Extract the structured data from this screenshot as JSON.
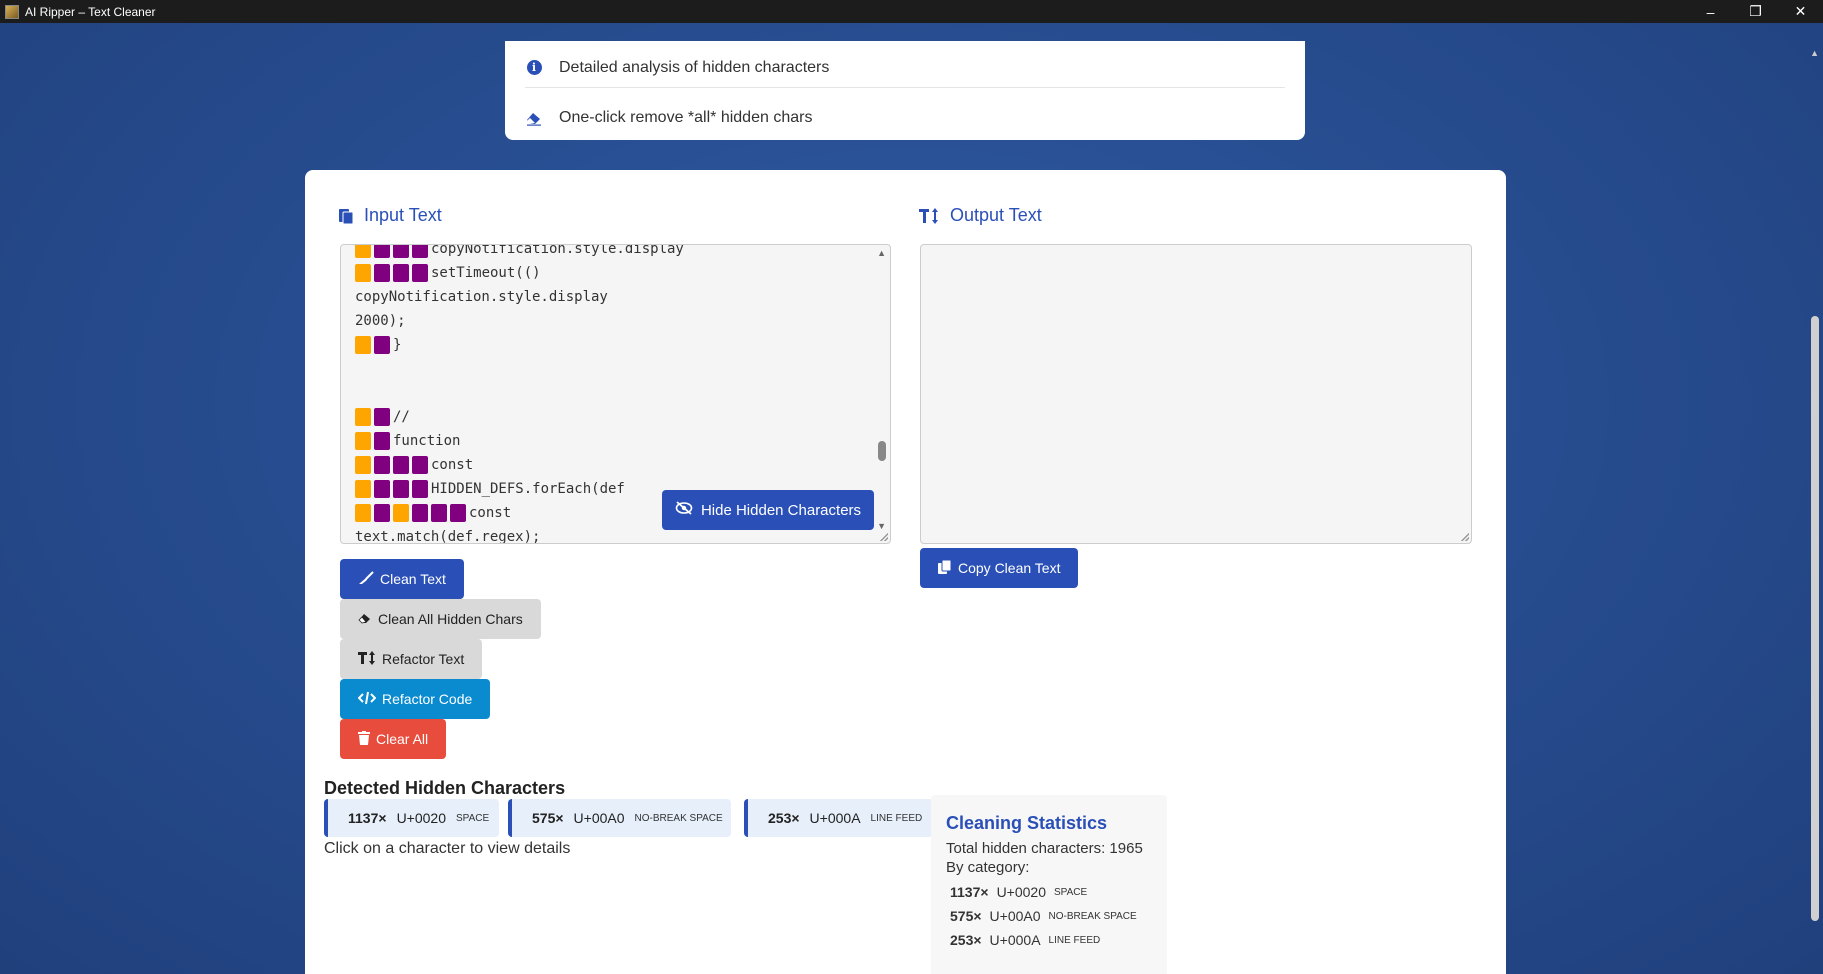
{
  "window": {
    "title": "AI Ripper – Text Cleaner",
    "controls": [
      "–",
      "❐",
      "✕"
    ]
  },
  "features": [
    {
      "icon": "info-icon",
      "text": "Detailed analysis of hidden characters"
    },
    {
      "icon": "eraser-icon",
      "text": "One-click remove *all* hidden chars"
    }
  ],
  "input": {
    "title": "Input Text",
    "lines": [
      {
        "markers": "oppp",
        "text": "copyNotification.style.display"
      },
      {
        "markers": "oppp",
        "text": "setTimeout(()"
      },
      {
        "markers": "",
        "text": "copyNotification.style.display"
      },
      {
        "markers": "",
        "text": "2000);"
      },
      {
        "markers": "op",
        "text": "}"
      },
      {
        "markers": "",
        "text": ""
      },
      {
        "markers": "",
        "text": ""
      },
      {
        "markers": "op",
        "text": "//"
      },
      {
        "markers": "op",
        "text": "function"
      },
      {
        "markers": "oppp",
        "text": "const"
      },
      {
        "markers": "oppp",
        "text": "HIDDEN_DEFS.forEach(def"
      },
      {
        "markers": "opoppp",
        "text": "const"
      },
      {
        "markers": "",
        "text": "text.match(def.regex);"
      }
    ],
    "hide_button": "Hide Hidden Characters"
  },
  "output": {
    "title": "Output Text",
    "copy_button": "Copy Clean Text"
  },
  "actions": {
    "clean_text": "Clean Text",
    "clean_all": "Clean All Hidden Chars",
    "refactor_text": "Refactor Text",
    "refactor_code": "Refactor Code",
    "clear_all": "Clear All"
  },
  "detected": {
    "title": "Detected Hidden Characters",
    "chips": [
      {
        "count": "1137×",
        "code": "U+0020",
        "name": "SPACE"
      },
      {
        "count": "575×",
        "code": "U+00A0",
        "name": "NO-BREAK SPACE"
      },
      {
        "count": "253×",
        "code": "U+000A",
        "name": "LINE FEED"
      }
    ],
    "hint": "Click on a character to view details"
  },
  "stats": {
    "title": "Cleaning Statistics",
    "total": "Total hidden characters: 1965",
    "by_category": "By category:",
    "rows": [
      {
        "count": "1137×",
        "code": "U+0020",
        "name": "SPACE"
      },
      {
        "count": "575×",
        "code": "U+00A0",
        "name": "NO-BREAK SPACE"
      },
      {
        "count": "253×",
        "code": "U+000A",
        "name": "LINE FEED"
      }
    ]
  },
  "colors": {
    "accent": "#2a50b8",
    "marker_space": "#ffa500",
    "marker_nbsp": "#800080",
    "danger": "#e74c3c",
    "info": "#0a8bd0"
  }
}
